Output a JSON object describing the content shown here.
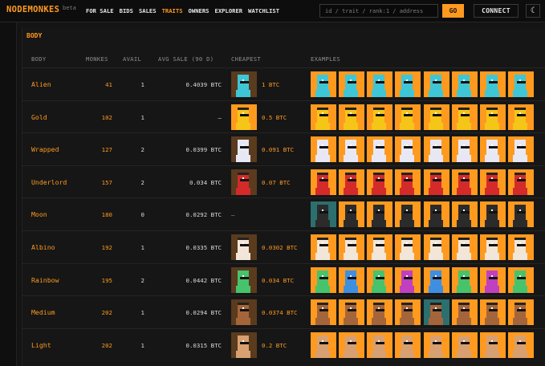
{
  "app": {
    "logo": "NODEMONKES",
    "beta": "beta",
    "nav": [
      {
        "label": "FOR SALE",
        "active": false
      },
      {
        "label": "BIDS",
        "active": false
      },
      {
        "label": "SALES",
        "active": false
      },
      {
        "label": "TRAITS",
        "active": true
      },
      {
        "label": "OWNERS",
        "active": false
      },
      {
        "label": "EXPLORER",
        "active": false
      },
      {
        "label": "WATCHLIST",
        "active": false
      }
    ],
    "search_placeholder": "id / trait / rank:1 / address",
    "go_label": "GO",
    "connect_label": "CONNECT",
    "theme_icon": "moon-icon"
  },
  "section": {
    "title": "BODY",
    "headers": {
      "body": "BODY",
      "monkes": "MONKES",
      "avail": "AVAIL",
      "avg": "AVG SALE (90 D)",
      "cheapest": "CHEAPEST",
      "examples": "EXAMPLES"
    }
  },
  "colors": {
    "accent": "#ff9a1f",
    "background": "#141414",
    "tile_bg": "#ff9a1f"
  },
  "rows": [
    {
      "name": "Alien",
      "monkes": "41",
      "avail": "1",
      "avg": "0.4039 BTC",
      "cheapest": "1 BTC",
      "has_cheapest": true,
      "cheap_bg": "#5a3b1e",
      "skin": "#3fc6d6",
      "examples": [
        {
          "bg": "#ff9a1f",
          "skin": "#3fc6d6"
        },
        {
          "bg": "#ff9a1f",
          "skin": "#3fc6d6"
        },
        {
          "bg": "#ff9a1f",
          "skin": "#3fc6d6"
        },
        {
          "bg": "#ff9a1f",
          "skin": "#3fc6d6"
        },
        {
          "bg": "#ff9a1f",
          "skin": "#3fc6d6"
        },
        {
          "bg": "#ff9a1f",
          "skin": "#3fc6d6"
        },
        {
          "bg": "#ff9a1f",
          "skin": "#3fc6d6"
        },
        {
          "bg": "#ff9a1f",
          "skin": "#3fc6d6"
        }
      ]
    },
    {
      "name": "Gold",
      "monkes": "102",
      "avail": "1",
      "avg": "—",
      "cheapest": "0.5 BTC",
      "has_cheapest": true,
      "cheap_bg": "#ff9a1f",
      "skin": "#f5c518",
      "examples": [
        {
          "bg": "#ff9a1f",
          "skin": "#f5c518"
        },
        {
          "bg": "#ff9a1f",
          "skin": "#f5c518"
        },
        {
          "bg": "#ff9a1f",
          "skin": "#f5c518"
        },
        {
          "bg": "#ff9a1f",
          "skin": "#f5c518"
        },
        {
          "bg": "#ff9a1f",
          "skin": "#f5c518"
        },
        {
          "bg": "#ff9a1f",
          "skin": "#f5c518"
        },
        {
          "bg": "#ff9a1f",
          "skin": "#f5c518"
        },
        {
          "bg": "#ff9a1f",
          "skin": "#f5c518"
        }
      ]
    },
    {
      "name": "Wrapped",
      "monkes": "127",
      "avail": "2",
      "avg": "0.0399 BTC",
      "cheapest": "0.091 BTC",
      "has_cheapest": true,
      "cheap_bg": "#5a3b1e",
      "skin": "#e8e8f5",
      "examples": [
        {
          "bg": "#ff9a1f",
          "skin": "#e8e8f5"
        },
        {
          "bg": "#ff9a1f",
          "skin": "#e8e8f5"
        },
        {
          "bg": "#ff9a1f",
          "skin": "#e8e8f5"
        },
        {
          "bg": "#ff9a1f",
          "skin": "#e8e8f5"
        },
        {
          "bg": "#ff9a1f",
          "skin": "#e8e8f5"
        },
        {
          "bg": "#ff9a1f",
          "skin": "#e8e8f5"
        },
        {
          "bg": "#ff9a1f",
          "skin": "#e8e8f5"
        },
        {
          "bg": "#ff9a1f",
          "skin": "#e8e8f5"
        }
      ]
    },
    {
      "name": "Underlord",
      "monkes": "157",
      "avail": "2",
      "avg": "0.034 BTC",
      "cheapest": "0.07 BTC",
      "has_cheapest": true,
      "cheap_bg": "#5a3b1e",
      "skin": "#d42a2a",
      "examples": [
        {
          "bg": "#ff9a1f",
          "skin": "#d42a2a"
        },
        {
          "bg": "#ff9a1f",
          "skin": "#d42a2a"
        },
        {
          "bg": "#ff9a1f",
          "skin": "#d42a2a"
        },
        {
          "bg": "#ff9a1f",
          "skin": "#d42a2a"
        },
        {
          "bg": "#ff9a1f",
          "skin": "#d42a2a"
        },
        {
          "bg": "#ff9a1f",
          "skin": "#d42a2a"
        },
        {
          "bg": "#ff9a1f",
          "skin": "#d42a2a"
        },
        {
          "bg": "#ff9a1f",
          "skin": "#d42a2a"
        }
      ]
    },
    {
      "name": "Moon",
      "monkes": "180",
      "avail": "0",
      "avg": "0.0292 BTC",
      "cheapest": "—",
      "has_cheapest": false,
      "cheap_bg": "",
      "skin": "#2b2b2b",
      "examples": [
        {
          "bg": "#2c6f6f",
          "skin": "#2b2b2b"
        },
        {
          "bg": "#ff9a1f",
          "skin": "#2b2b2b"
        },
        {
          "bg": "#ff9a1f",
          "skin": "#2b2b2b"
        },
        {
          "bg": "#ff9a1f",
          "skin": "#2b2b2b"
        },
        {
          "bg": "#ff9a1f",
          "skin": "#2b2b2b"
        },
        {
          "bg": "#ff9a1f",
          "skin": "#2b2b2b"
        },
        {
          "bg": "#ff9a1f",
          "skin": "#2b2b2b"
        },
        {
          "bg": "#ff9a1f",
          "skin": "#2b2b2b"
        }
      ]
    },
    {
      "name": "Albino",
      "monkes": "192",
      "avail": "1",
      "avg": "0.0335 BTC",
      "cheapest": "0.0302 BTC",
      "has_cheapest": true,
      "cheap_bg": "#5a3b1e",
      "skin": "#f2e6d8",
      "examples": [
        {
          "bg": "#ff9a1f",
          "skin": "#f2e6d8"
        },
        {
          "bg": "#ff9a1f",
          "skin": "#f2e6d8"
        },
        {
          "bg": "#ff9a1f",
          "skin": "#f2e6d8"
        },
        {
          "bg": "#ff9a1f",
          "skin": "#f2e6d8"
        },
        {
          "bg": "#ff9a1f",
          "skin": "#f2e6d8"
        },
        {
          "bg": "#ff9a1f",
          "skin": "#f2e6d8"
        },
        {
          "bg": "#ff9a1f",
          "skin": "#f2e6d8"
        },
        {
          "bg": "#ff9a1f",
          "skin": "#f2e6d8"
        }
      ]
    },
    {
      "name": "Rainbow",
      "monkes": "195",
      "avail": "2",
      "avg": "0.0442 BTC",
      "cheapest": "0.034 BTC",
      "has_cheapest": true,
      "cheap_bg": "#5a3b1e",
      "skin": "#46c36b",
      "examples": [
        {
          "bg": "#ff9a1f",
          "skin": "#46c36b"
        },
        {
          "bg": "#ff9a1f",
          "skin": "#3f8fe0"
        },
        {
          "bg": "#ff9a1f",
          "skin": "#46c36b"
        },
        {
          "bg": "#ff9a1f",
          "skin": "#c040c0"
        },
        {
          "bg": "#ff9a1f",
          "skin": "#3f8fe0"
        },
        {
          "bg": "#ff9a1f",
          "skin": "#46c36b"
        },
        {
          "bg": "#ff9a1f",
          "skin": "#c040c0"
        },
        {
          "bg": "#ff9a1f",
          "skin": "#46c36b"
        }
      ]
    },
    {
      "name": "Medium",
      "monkes": "202",
      "avail": "1",
      "avg": "0.0294 BTC",
      "cheapest": "0.0374 BTC",
      "has_cheapest": true,
      "cheap_bg": "#5a3b1e",
      "skin": "#a5653a",
      "examples": [
        {
          "bg": "#ff9a1f",
          "skin": "#a5653a"
        },
        {
          "bg": "#ff9a1f",
          "skin": "#a5653a"
        },
        {
          "bg": "#ff9a1f",
          "skin": "#a5653a"
        },
        {
          "bg": "#ff9a1f",
          "skin": "#a5653a"
        },
        {
          "bg": "#2c6f6f",
          "skin": "#a5653a"
        },
        {
          "bg": "#ff9a1f",
          "skin": "#a5653a"
        },
        {
          "bg": "#ff9a1f",
          "skin": "#a5653a"
        },
        {
          "bg": "#ff9a1f",
          "skin": "#a5653a"
        }
      ]
    },
    {
      "name": "Light",
      "monkes": "202",
      "avail": "1",
      "avg": "0.0315 BTC",
      "cheapest": "0.2 BTC",
      "has_cheapest": true,
      "cheap_bg": "#5a3b1e",
      "skin": "#d8a070",
      "examples": [
        {
          "bg": "#ff9a1f",
          "skin": "#d8a070"
        },
        {
          "bg": "#ff9a1f",
          "skin": "#d8a070"
        },
        {
          "bg": "#ff9a1f",
          "skin": "#d8a070"
        },
        {
          "bg": "#ff9a1f",
          "skin": "#d8a070"
        },
        {
          "bg": "#ff9a1f",
          "skin": "#d8a070"
        },
        {
          "bg": "#ff9a1f",
          "skin": "#d8a070"
        },
        {
          "bg": "#ff9a1f",
          "skin": "#d8a070"
        },
        {
          "bg": "#ff9a1f",
          "skin": "#d8a070"
        }
      ]
    }
  ]
}
